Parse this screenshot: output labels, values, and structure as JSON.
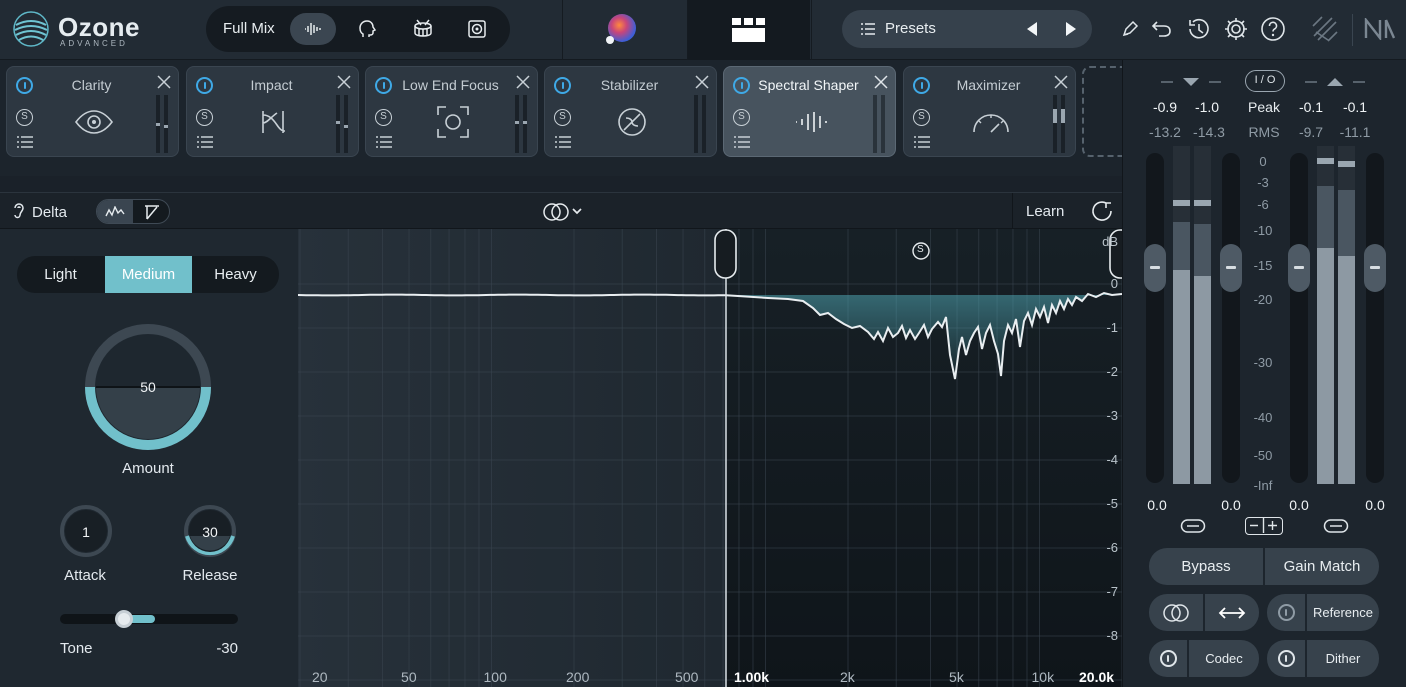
{
  "app": {
    "name": "Ozone",
    "edition": "ADVANCED"
  },
  "header": {
    "mode_label": "Full Mix",
    "mode_icons": [
      "waveform-icon",
      "vocal-head-icon",
      "drum-icon",
      "speaker-icon"
    ],
    "presets_label": "Presets",
    "toolbar_icons": [
      "pencil-icon",
      "undo-icon",
      "history-icon",
      "gear-icon",
      "help-icon",
      "ozone-sync-icon",
      "ni-logo-icon"
    ]
  },
  "modules": [
    {
      "name": "Clarity",
      "icon": "eye-icon",
      "selected": false
    },
    {
      "name": "Impact",
      "icon": "impact-icon",
      "selected": false
    },
    {
      "name": "Low End Focus",
      "icon": "focus-frame-icon",
      "selected": false
    },
    {
      "name": "Stabilizer",
      "icon": "stabilizer-icon",
      "selected": false
    },
    {
      "name": "Spectral Shaper",
      "icon": "spectral-bars-icon",
      "selected": true
    },
    {
      "name": "Maximizer",
      "icon": "gauge-icon",
      "selected": false
    }
  ],
  "toolbar": {
    "delta_label": "Delta",
    "learn_label": "Learn"
  },
  "controls": {
    "modes": [
      "Light",
      "Medium",
      "Heavy"
    ],
    "active_mode": "Medium",
    "amount": {
      "label": "Amount",
      "value": "50",
      "level": 0.5
    },
    "attack": {
      "label": "Attack",
      "value": "1"
    },
    "release": {
      "label": "Release",
      "value": "30"
    },
    "tone": {
      "label": "Tone",
      "value": "-30"
    }
  },
  "spectrum": {
    "db_unit": "dB",
    "db_labels": [
      "0",
      "-1",
      "-2",
      "-3",
      "-4",
      "-5",
      "-6",
      "-7",
      "-8"
    ],
    "freq_labels": [
      "20",
      "50",
      "100",
      "200",
      "500",
      "1.00k",
      "2k",
      "5k",
      "10k",
      "20.0k"
    ],
    "band_handle_solo": "S"
  },
  "meters": {
    "peak_label": "Peak",
    "rms_label": "RMS",
    "io_label": "I / O",
    "input_peak": [
      "-0.9",
      "-1.0"
    ],
    "input_rms": [
      "-13.2",
      "-14.3"
    ],
    "output_peak": [
      "-0.1",
      "-0.1"
    ],
    "output_rms": [
      "-9.7",
      "-11.1"
    ],
    "scale": [
      "0",
      "-3",
      "-6",
      "-10",
      "-15",
      "-20",
      "-30",
      "-40",
      "-50",
      "-Inf"
    ],
    "gains": [
      "0.0",
      "0.0",
      "0.0",
      "0.0"
    ]
  },
  "bottom": {
    "bypass_label": "Bypass",
    "gain_match_label": "Gain Match",
    "reference_label": "Reference",
    "codec_label": "Codec",
    "dither_label": "Dither"
  }
}
